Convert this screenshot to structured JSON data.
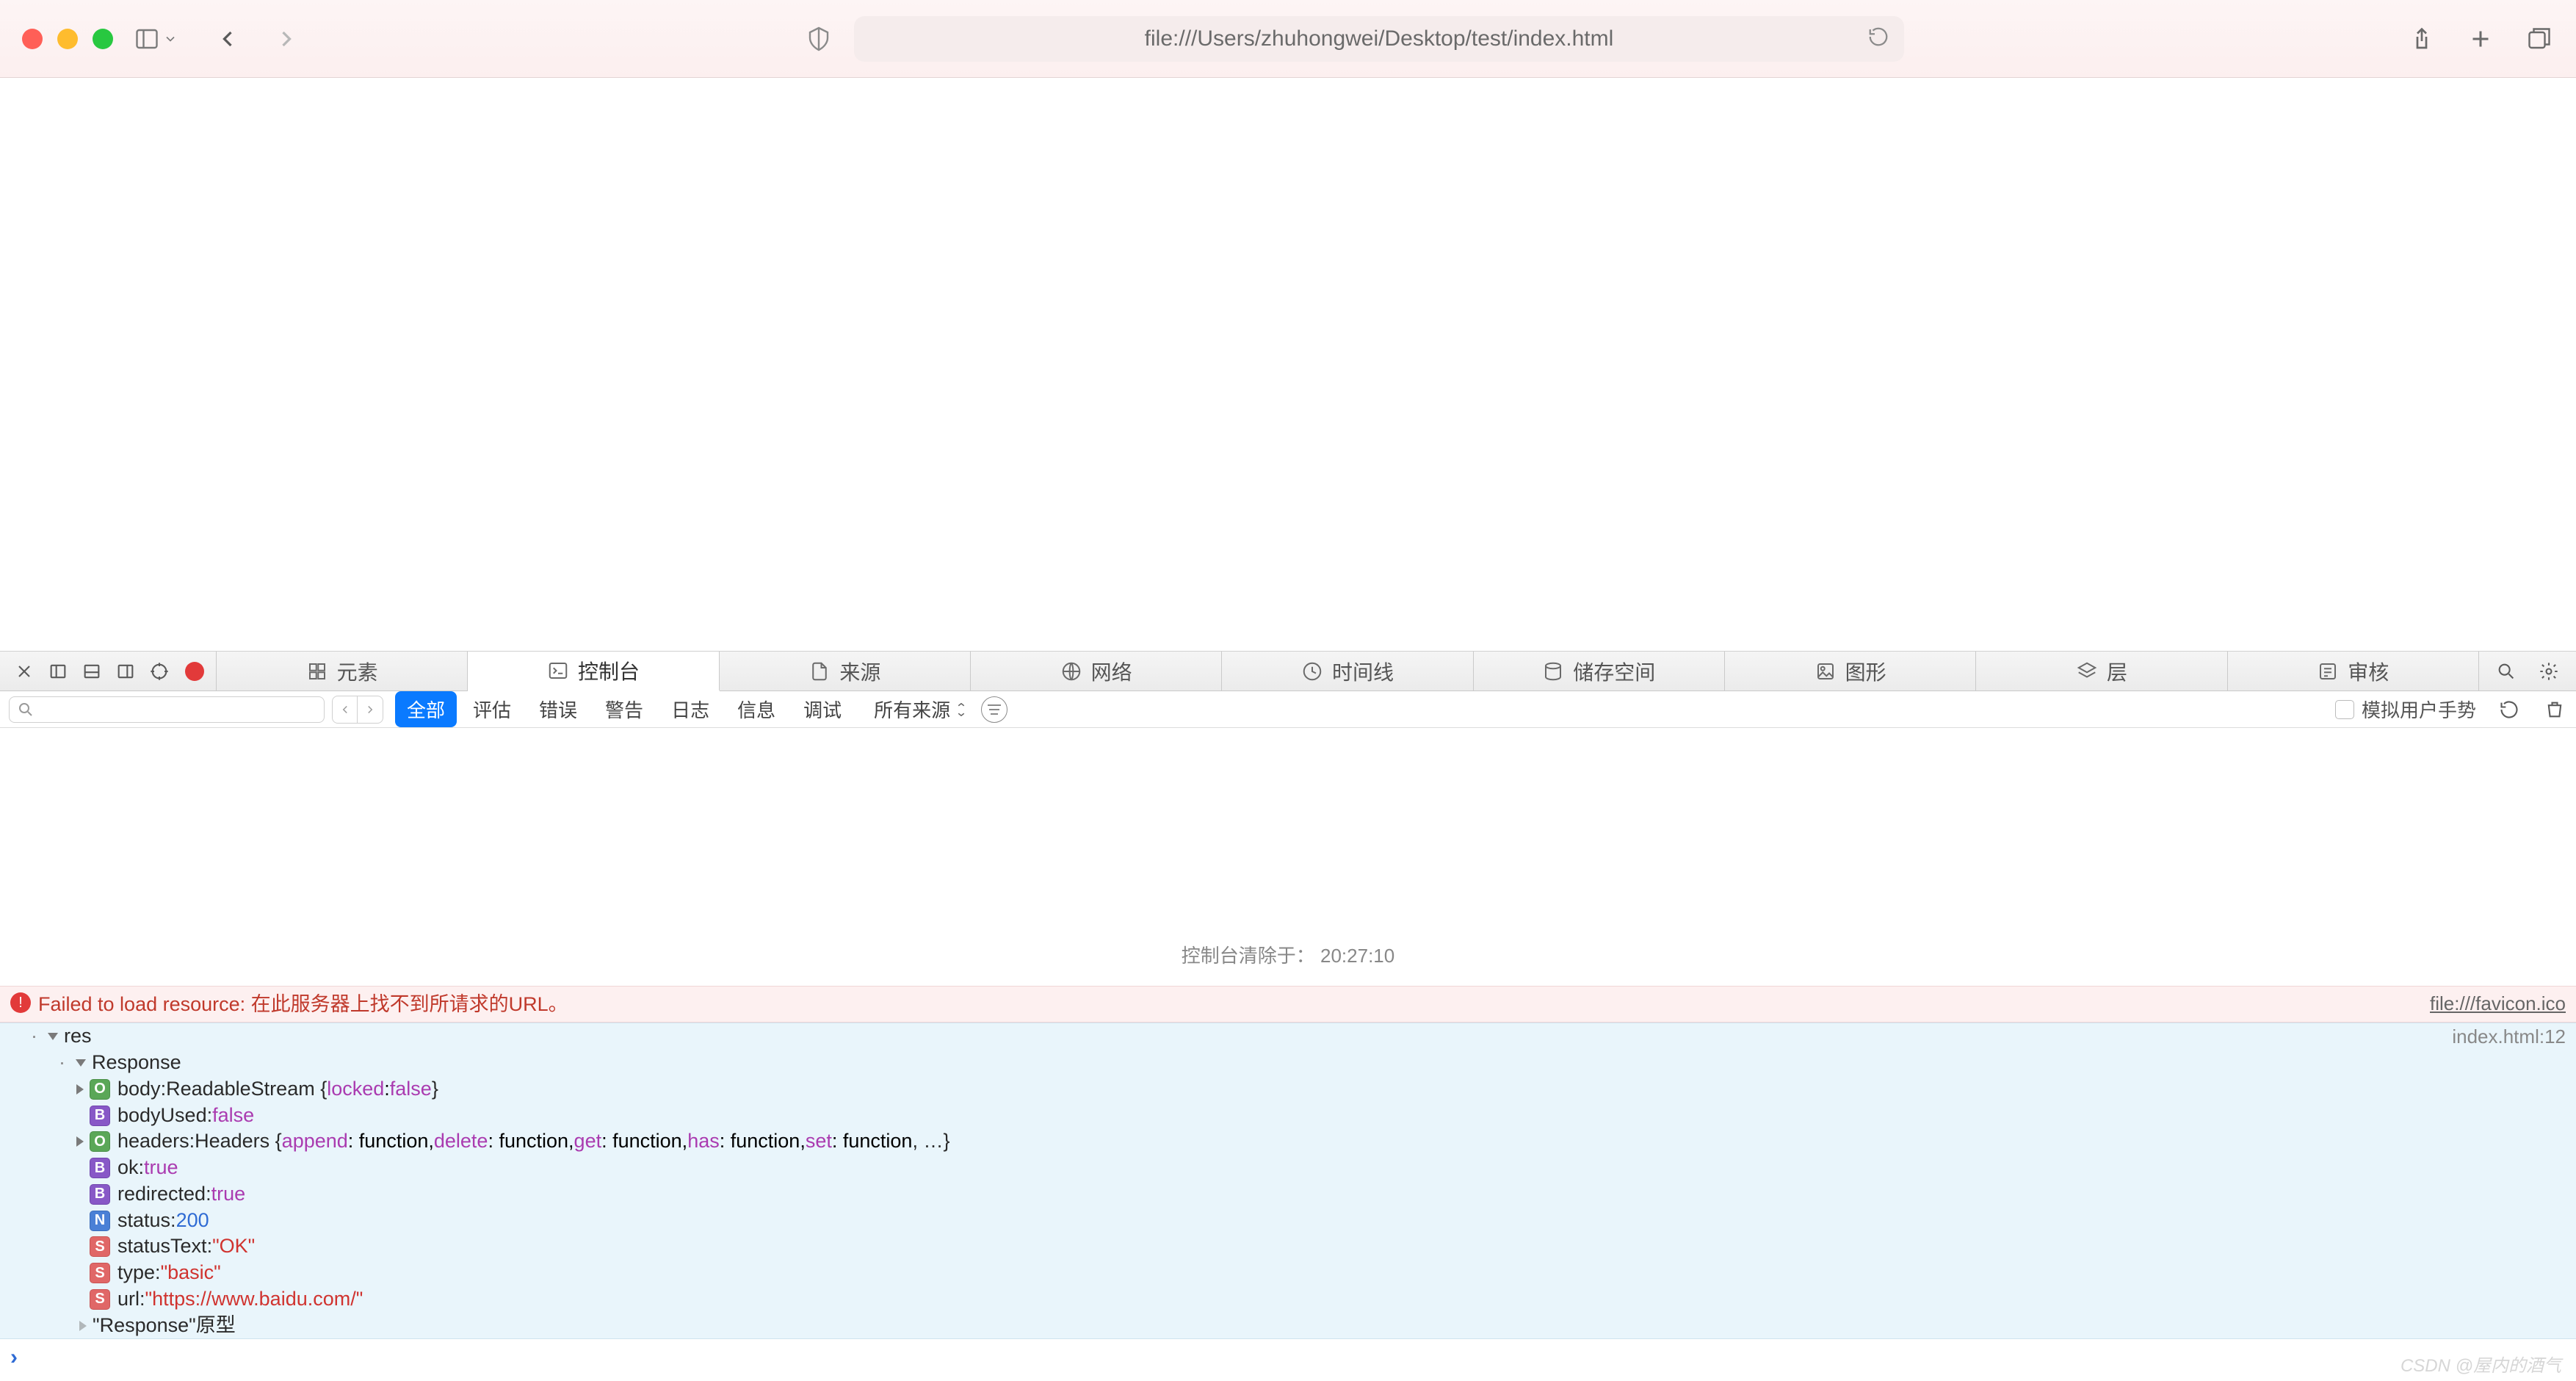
{
  "browser": {
    "url": "file:///Users/zhuhongwei/Desktop/test/index.html"
  },
  "devtools": {
    "tabs": [
      "元素",
      "控制台",
      "来源",
      "网络",
      "时间线",
      "储存空间",
      "图形",
      "层",
      "审核"
    ],
    "activeTab": "控制台"
  },
  "consoleFilter": {
    "tabs": [
      "全部",
      "评估",
      "错误",
      "警告",
      "日志",
      "信息",
      "调试"
    ],
    "selected": "全部",
    "sourceDropdown": "所有来源",
    "simulateGesture": "模拟用户手势"
  },
  "console": {
    "clearedText": "控制台清除于： 20:27:10",
    "error": {
      "message": "Failed to load resource: 在此服务器上找不到所请求的URL。",
      "source": "file:///favicon.ico"
    },
    "log": {
      "root": "res",
      "source": "index.html:12",
      "constructor": "Response",
      "props": [
        {
          "badge": "O",
          "arrow": true,
          "key": "body",
          "val": "ReadableStream {",
          "inner": [
            [
              "locked",
              "false",
              "purple"
            ]
          ],
          "close": "}"
        },
        {
          "badge": "B",
          "arrow": false,
          "key": "bodyUsed",
          "val": "false",
          "cls": "purple"
        },
        {
          "badge": "O",
          "arrow": true,
          "key": "headers",
          "val": "Headers {",
          "innerFns": [
            "append",
            "delete",
            "get",
            "has",
            "set"
          ],
          "close": ", …}"
        },
        {
          "badge": "B",
          "arrow": false,
          "key": "ok",
          "val": "true",
          "cls": "purple"
        },
        {
          "badge": "B",
          "arrow": false,
          "key": "redirected",
          "val": "true",
          "cls": "purple"
        },
        {
          "badge": "N",
          "arrow": false,
          "key": "status",
          "val": "200",
          "cls": "blue"
        },
        {
          "badge": "S",
          "arrow": false,
          "key": "statusText",
          "val": "\"OK\"",
          "cls": "string"
        },
        {
          "badge": "S",
          "arrow": false,
          "key": "type",
          "val": "\"basic\"",
          "cls": "string"
        },
        {
          "badge": "S",
          "arrow": false,
          "key": "url",
          "val": "\"https://www.baidu.com/\"",
          "cls": "string"
        }
      ],
      "proto": "\"Response\"原型"
    }
  },
  "watermark": "CSDN @屋内的酒气"
}
